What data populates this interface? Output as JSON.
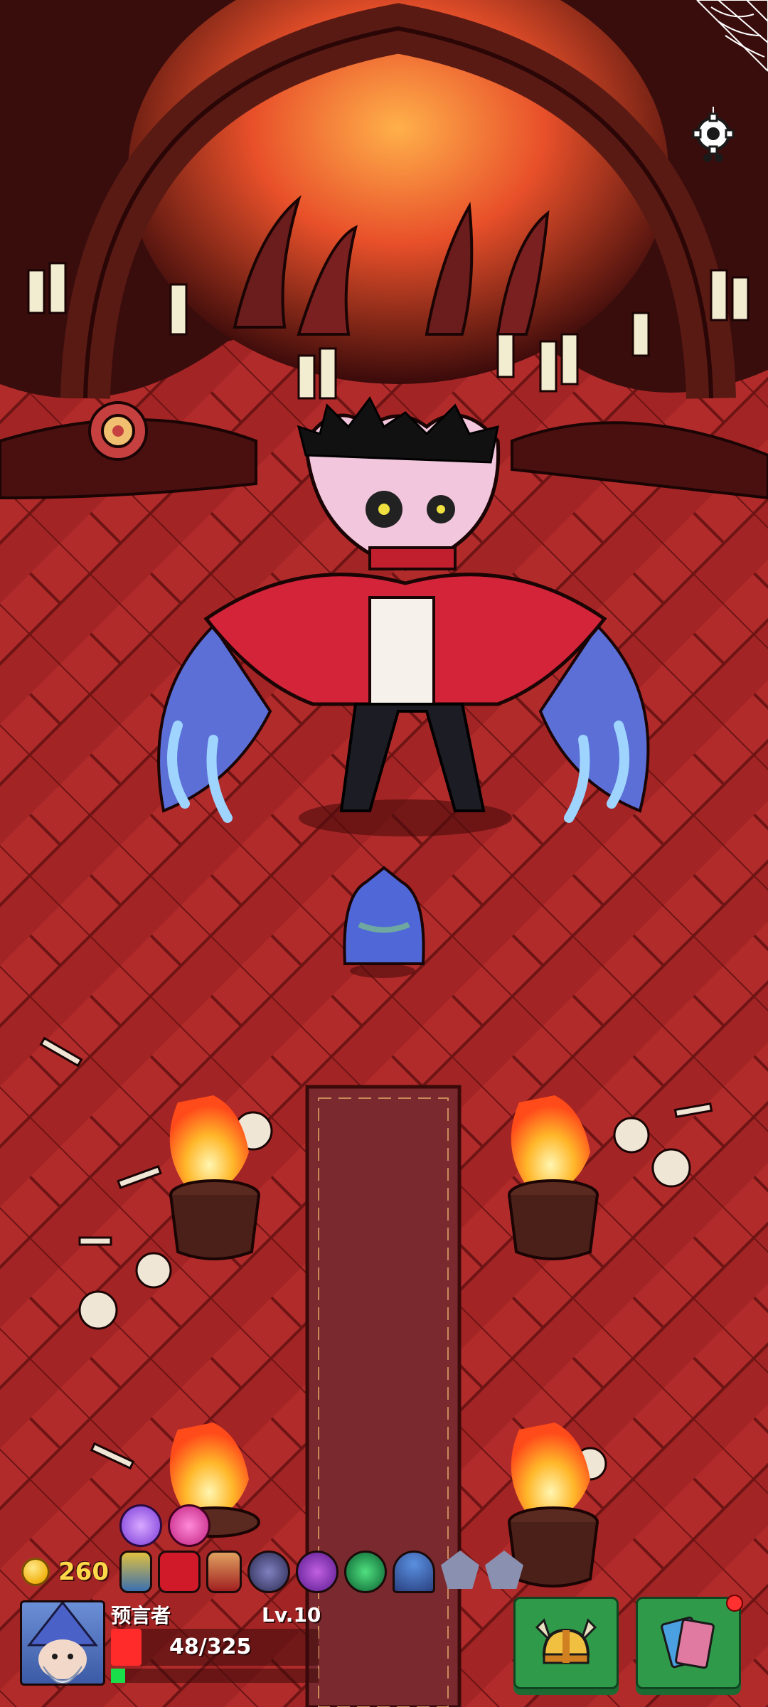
{
  "hud": {
    "coins": "260",
    "player": {
      "name": "预言者",
      "level": "Lv.10",
      "hp_text": "48/325",
      "hp_fraction": 0.148,
      "xp_fraction": 0.05
    }
  },
  "status_effects": {
    "row1": [
      "purple-orb-icon",
      "pink-demon-icon"
    ],
    "row2": [
      "lantern-icon",
      "red-heart-book-icon",
      "hourglass-icon",
      "bat-icon",
      "purple-shield-icon",
      "green-leaf-icon",
      "mushroom-icon",
      "pentagon-rune-icon",
      "pentagon-shield-icon"
    ]
  },
  "buttons": {
    "equipment": "helmet-icon",
    "cards": "cards-icon",
    "settings": "gear-icon"
  },
  "colors": {
    "floor": "#a52626",
    "hp": "#ff2a2a",
    "xp": "#19e04a",
    "button_green": "#2f9a4a",
    "coin": "#f2b515"
  }
}
